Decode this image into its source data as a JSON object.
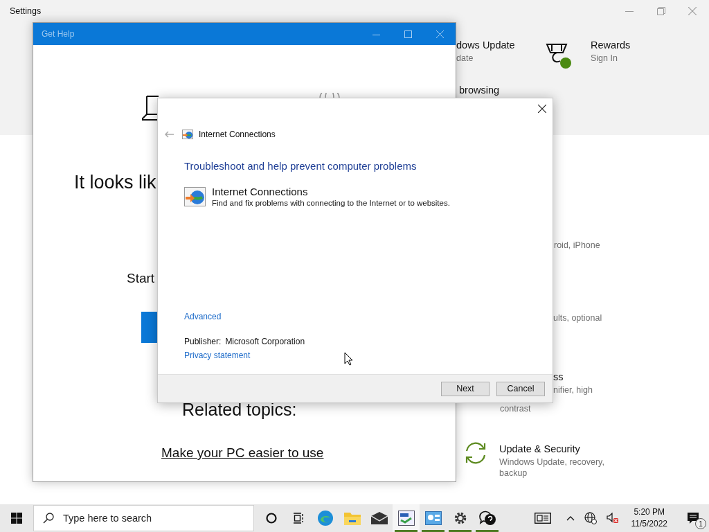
{
  "settings": {
    "title": "Settings",
    "items": [
      {
        "title": "dows Update",
        "subtitle": "date"
      },
      {
        "title": "browsing"
      },
      {
        "title": "Rewards",
        "subtitle": "Sign In"
      },
      {
        "subtitle": "roid, iPhone"
      },
      {
        "subtitle": "ults, optional"
      },
      {
        "title": "ss",
        "subtitle": "nifier, high"
      },
      {
        "subtitle": "contrast"
      },
      {
        "title": "Update & Security",
        "subtitle": "Windows Update, recovery, backup"
      }
    ]
  },
  "get_help": {
    "title": "Get Help",
    "heading": "It looks lik",
    "prompt": "Start",
    "related_heading": "Related topics:",
    "links": [
      "Make your PC easier to use"
    ]
  },
  "dialog": {
    "nav_title": "Internet Connections",
    "heading": "Troubleshoot and help prevent computer problems",
    "item": {
      "title": "Internet Connections",
      "description": "Find and fix problems with connecting to the Internet or to websites."
    },
    "advanced": "Advanced",
    "publisher_label": "Publisher:",
    "publisher": "Microsoft Corporation",
    "privacy": "Privacy statement",
    "buttons": [
      "Next",
      "Cancel"
    ]
  },
  "taskbar": {
    "search": {
      "placeholder": "Type here to search"
    },
    "apps": [
      {
        "running": false,
        "selected": false
      },
      {
        "running": false,
        "selected": false
      },
      {
        "running": false,
        "selected": false
      },
      {
        "running": false,
        "selected": false
      },
      {
        "running": false,
        "selected": false
      },
      {
        "running": true,
        "selected": true
      },
      {
        "running": true,
        "selected": false
      },
      {
        "running": true,
        "selected": false
      },
      {
        "running": true,
        "selected": false
      }
    ],
    "time": "5:20 PM",
    "date": "11/5/2022",
    "notifications": "1"
  }
}
